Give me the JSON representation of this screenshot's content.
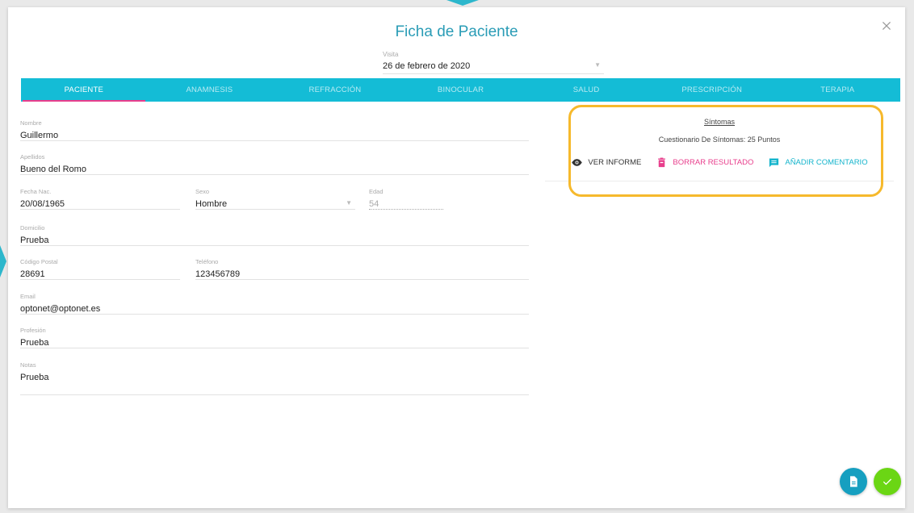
{
  "dialog": {
    "title": "Ficha de Paciente",
    "close_icon": "close-icon"
  },
  "visit": {
    "label": "Visita",
    "value": "26 de febrero de 2020"
  },
  "tabs": [
    {
      "label": "PACIENTE",
      "active": true
    },
    {
      "label": "ANAMNESIS",
      "active": false
    },
    {
      "label": "REFRACCIÓN",
      "active": false
    },
    {
      "label": "BINOCULAR",
      "active": false
    },
    {
      "label": "SALUD",
      "active": false
    },
    {
      "label": "PRESCRIPCIÓN",
      "active": false
    },
    {
      "label": "TERAPIA",
      "active": false
    }
  ],
  "patient": {
    "nombre": {
      "label": "Nombre",
      "value": "Guillermo"
    },
    "apellidos": {
      "label": "Apellidos",
      "value": "Bueno del Romo"
    },
    "fecha_nac": {
      "label": "Fecha Nac.",
      "value": "20/08/1965"
    },
    "sexo": {
      "label": "Sexo",
      "value": "Hombre"
    },
    "edad": {
      "label": "Edad",
      "value": "54"
    },
    "domicilio": {
      "label": "Domicilio",
      "value": "Prueba"
    },
    "codigo_postal": {
      "label": "Código Postal",
      "value": "28691"
    },
    "telefono": {
      "label": "Teléfono",
      "value": "123456789"
    },
    "email": {
      "label": "Email",
      "value": "optonet@optonet.es"
    },
    "profesion": {
      "label": "Profesión",
      "value": "Prueba"
    },
    "notas": {
      "label": "Notas",
      "value": "Prueba"
    }
  },
  "symptoms": {
    "title": "Síntomas",
    "description": "Cuestionario De Síntomas: 25 Puntos",
    "view_label": "VER INFORME",
    "delete_label": "BORRAR RESULTADO",
    "comment_label": "AÑADIR COMENTARIO"
  },
  "colors": {
    "accent": "#14bcd6",
    "title": "#2a9cb6",
    "delete": "#e83e8c",
    "confirm": "#6bd614",
    "highlight": "#f6b92c"
  }
}
